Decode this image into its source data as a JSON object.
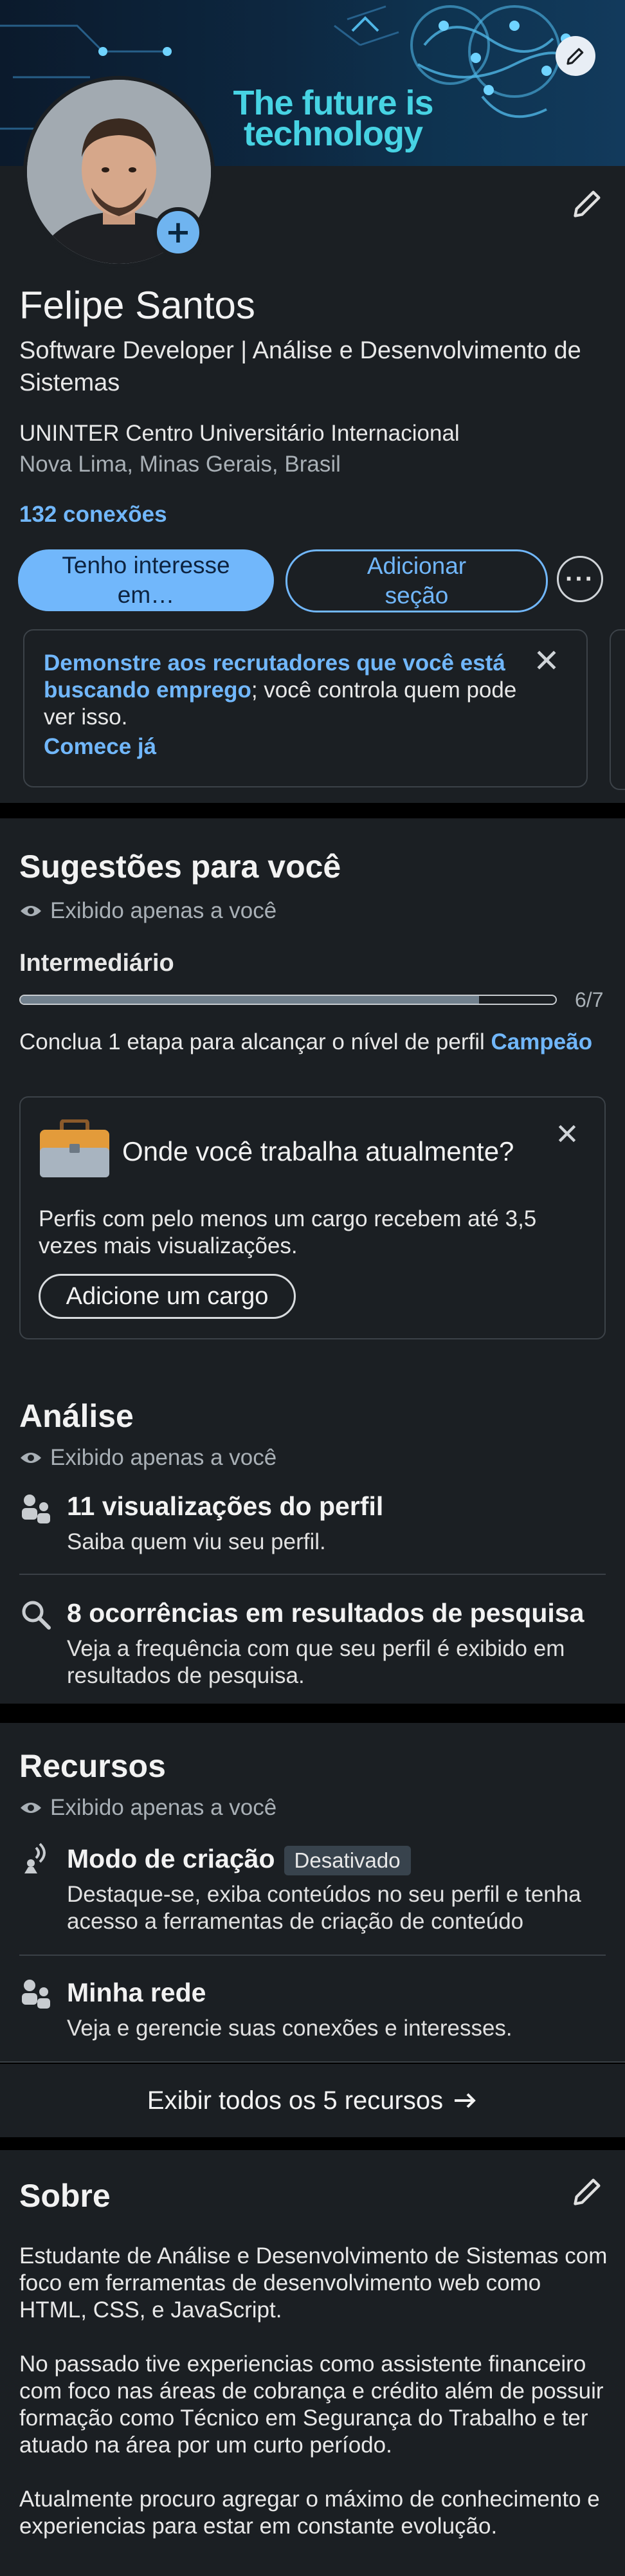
{
  "profile": {
    "banner_tagline": "The future is technology",
    "name": "Felipe Santos",
    "headline": "Software Developer | Análise e Desenvolvimento de Sistemas",
    "school": "UNINTER Centro Universitário Internacional",
    "location": "Nova Lima, Minas Gerais, Brasil",
    "connections": "132 conexões"
  },
  "actions": {
    "open_to": "Tenho interesse em…",
    "add_section": "Adicionar seção"
  },
  "promo": {
    "highlight": "Demonstre aos recrutadores que você está buscando emprego",
    "rest": "; você controla quem pode ver isso.",
    "cta": "Comece já"
  },
  "suggestions": {
    "title": "Sugestões para você",
    "private_label": "Exibido apenas a você",
    "level": "Intermediário",
    "progress": {
      "completed": 6,
      "total": 7,
      "label": "6/7"
    },
    "note_prefix": "Conclua 1 etapa para alcançar o nível de perfil ",
    "note_level": "Campeão",
    "job_card": {
      "title": "Onde você trabalha atualmente?",
      "description": "Perfis com pelo menos um cargo recebem até 3,5 vezes mais visualizações.",
      "button": "Adicione um cargo"
    }
  },
  "analytics": {
    "title": "Análise",
    "private_label": "Exibido apenas a você",
    "items": [
      {
        "icon": "people-icon",
        "title": "11 visualizações do perfil",
        "subtitle": "Saiba quem viu seu perfil."
      },
      {
        "icon": "search-icon",
        "title": "8 ocorrências em resultados de pesquisa",
        "subtitle": "Veja a frequência com que seu perfil é exibido em resultados de pesquisa."
      }
    ]
  },
  "resources": {
    "title": "Recursos",
    "private_label": "Exibido apenas a você",
    "items": [
      {
        "icon": "broadcast-icon",
        "title": "Modo de criação",
        "badge": "Desativado",
        "subtitle": "Destaque-se, exiba conteúdos no seu perfil e tenha acesso a ferramentas de criação de conteúdo"
      },
      {
        "icon": "people-icon",
        "title": "Minha rede",
        "subtitle": "Veja e gerencie suas conexões e interesses."
      }
    ],
    "show_all": "Exibir todos os 5 recursos"
  },
  "about": {
    "title": "Sobre",
    "paragraphs": [
      "Estudante de Análise e Desenvolvimento de Sistemas com foco em ferramentas de desenvolvimento web como HTML, CSS, e JavaScript.",
      "No passado tive experiencias como assistente financeiro com foco nas áreas de cobrança e crédito além de possuir formação como Técnico em Segurança do Trabalho e ter atuado na área por um curto período.",
      "Atualmente procuro agregar o máximo de conhecimento e experiencias para estar em constante evolução."
    ]
  },
  "colors": {
    "background": "#1b1f23",
    "accent": "#71b7fb",
    "separator": "#000000"
  }
}
